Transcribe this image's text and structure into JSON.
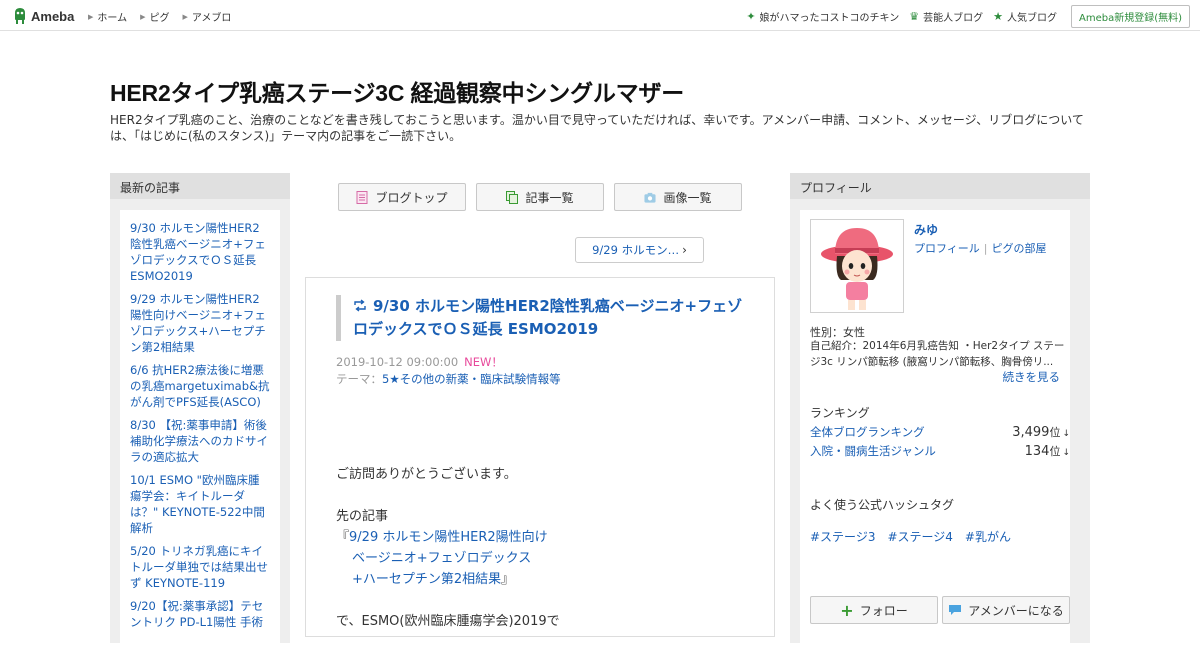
{
  "topbar": {
    "logo_text": "Ameba",
    "nav": [
      "ホーム",
      "ピグ",
      "アメブロ"
    ],
    "right_links": [
      {
        "label": "娘がハマったコストコのチキン",
        "icon": "sparkle-icon"
      },
      {
        "label": "芸能人ブログ",
        "icon": "crown-icon"
      },
      {
        "label": "人気ブログ",
        "icon": "star-icon"
      }
    ],
    "register_label": "Ameba新規登録(無料)"
  },
  "blog": {
    "title": "HER2タイプ乳癌ステージ3C 経過観察中シングルマザー",
    "description": "HER2タイプ乳癌のこと、治療のことなどを書き残しておこうと思います。温かい目で見守っていただければ、幸いです。アメンバー申請、コメント、メッセージ、リブログについては、「はじめに(私のスタンス)」テーマ内の記事をご一読下さい。"
  },
  "sidebar_left": {
    "heading": "最新の記事",
    "entries": [
      "9/30 ホルモン陽性HER2陰性乳癌ベージニオ+フェゾロデックスでＯＳ延長 ESMO2019",
      "9/29 ホルモン陽性HER2陽性向けベージニオ+フェゾロデックス+ハーセプチン第2相結果",
      "6/6 抗HER2療法後に増悪の乳癌margetuximab&抗がん剤でPFS延長(ASCO)",
      "8/30 【祝:薬事申請】術後補助化学療法へのカドサイラの適応拡大",
      "10/1 ESMO \"欧州臨床腫瘍学会：キイトルーダは？\" KEYNOTE-522中間解析",
      "5/20 トリネガ乳癌にキイトルーダ単独では結果出せず KEYNOTE-119",
      "9/20【祝:薬事承認】テセントリク PD-L1陽性 手術"
    ]
  },
  "tabs": {
    "blog_top": "ブログトップ",
    "article_list": "記事一覧",
    "image_list": "画像一覧"
  },
  "pager": {
    "prev_label": "9/29 ホルモン…"
  },
  "article": {
    "title": "9/30 ホルモン陽性HER2陰性乳癌ベージニオ+フェゾロデックスでＯＳ延長 ESMO2019",
    "date": "2019-10-12 09:00:00",
    "new_badge": "NEW！",
    "theme_prefix": "テーマ：",
    "theme": "5★その他の新薬・臨床試験情報等",
    "greeting": "ご訪問ありがとうございます。",
    "prev_article_label": "先の記事",
    "link_open": "『",
    "link_line1": "9/29 ホルモン陽性HER2陽性向け",
    "link_line2": "ベージニオ+フェゾロデックス",
    "link_line3": "+ハーセプチン第2相結果",
    "link_close": "』",
    "tail": "で、ESMO(欧州臨床腫瘍学会)2019で"
  },
  "profile": {
    "heading": "プロフィール",
    "name": "みゆ",
    "link_profile": "プロフィール",
    "link_separator": "|",
    "link_pig": "ピグの部屋",
    "gender": "性別：女性",
    "intro": "自己紹介：2014年6月乳癌告知 ・Her2タイプ ステージ3c リンパ節転移 (腋窩リンパ節転移、胸骨傍リ...",
    "more": "続きを見る",
    "ranking_heading": "ランキング",
    "rankings": [
      {
        "label": "全体ブログランキング",
        "value": "3,499",
        "unit": "位",
        "arrow": "↓"
      },
      {
        "label": "入院・闘病生活ジャンル",
        "value": "134",
        "unit": "位",
        "arrow": "↓"
      }
    ],
    "hashtag_heading": "よく使う公式ハッシュタグ",
    "hashtags": [
      "#ステージ3",
      "#ステージ4",
      "#乳がん"
    ],
    "follow_label": "フォロー",
    "amember_label": "アメンバーになる"
  },
  "colors": {
    "link": "#1a5fb4",
    "accent_green": "#2d8c3c",
    "new_pink": "#e8499b"
  }
}
